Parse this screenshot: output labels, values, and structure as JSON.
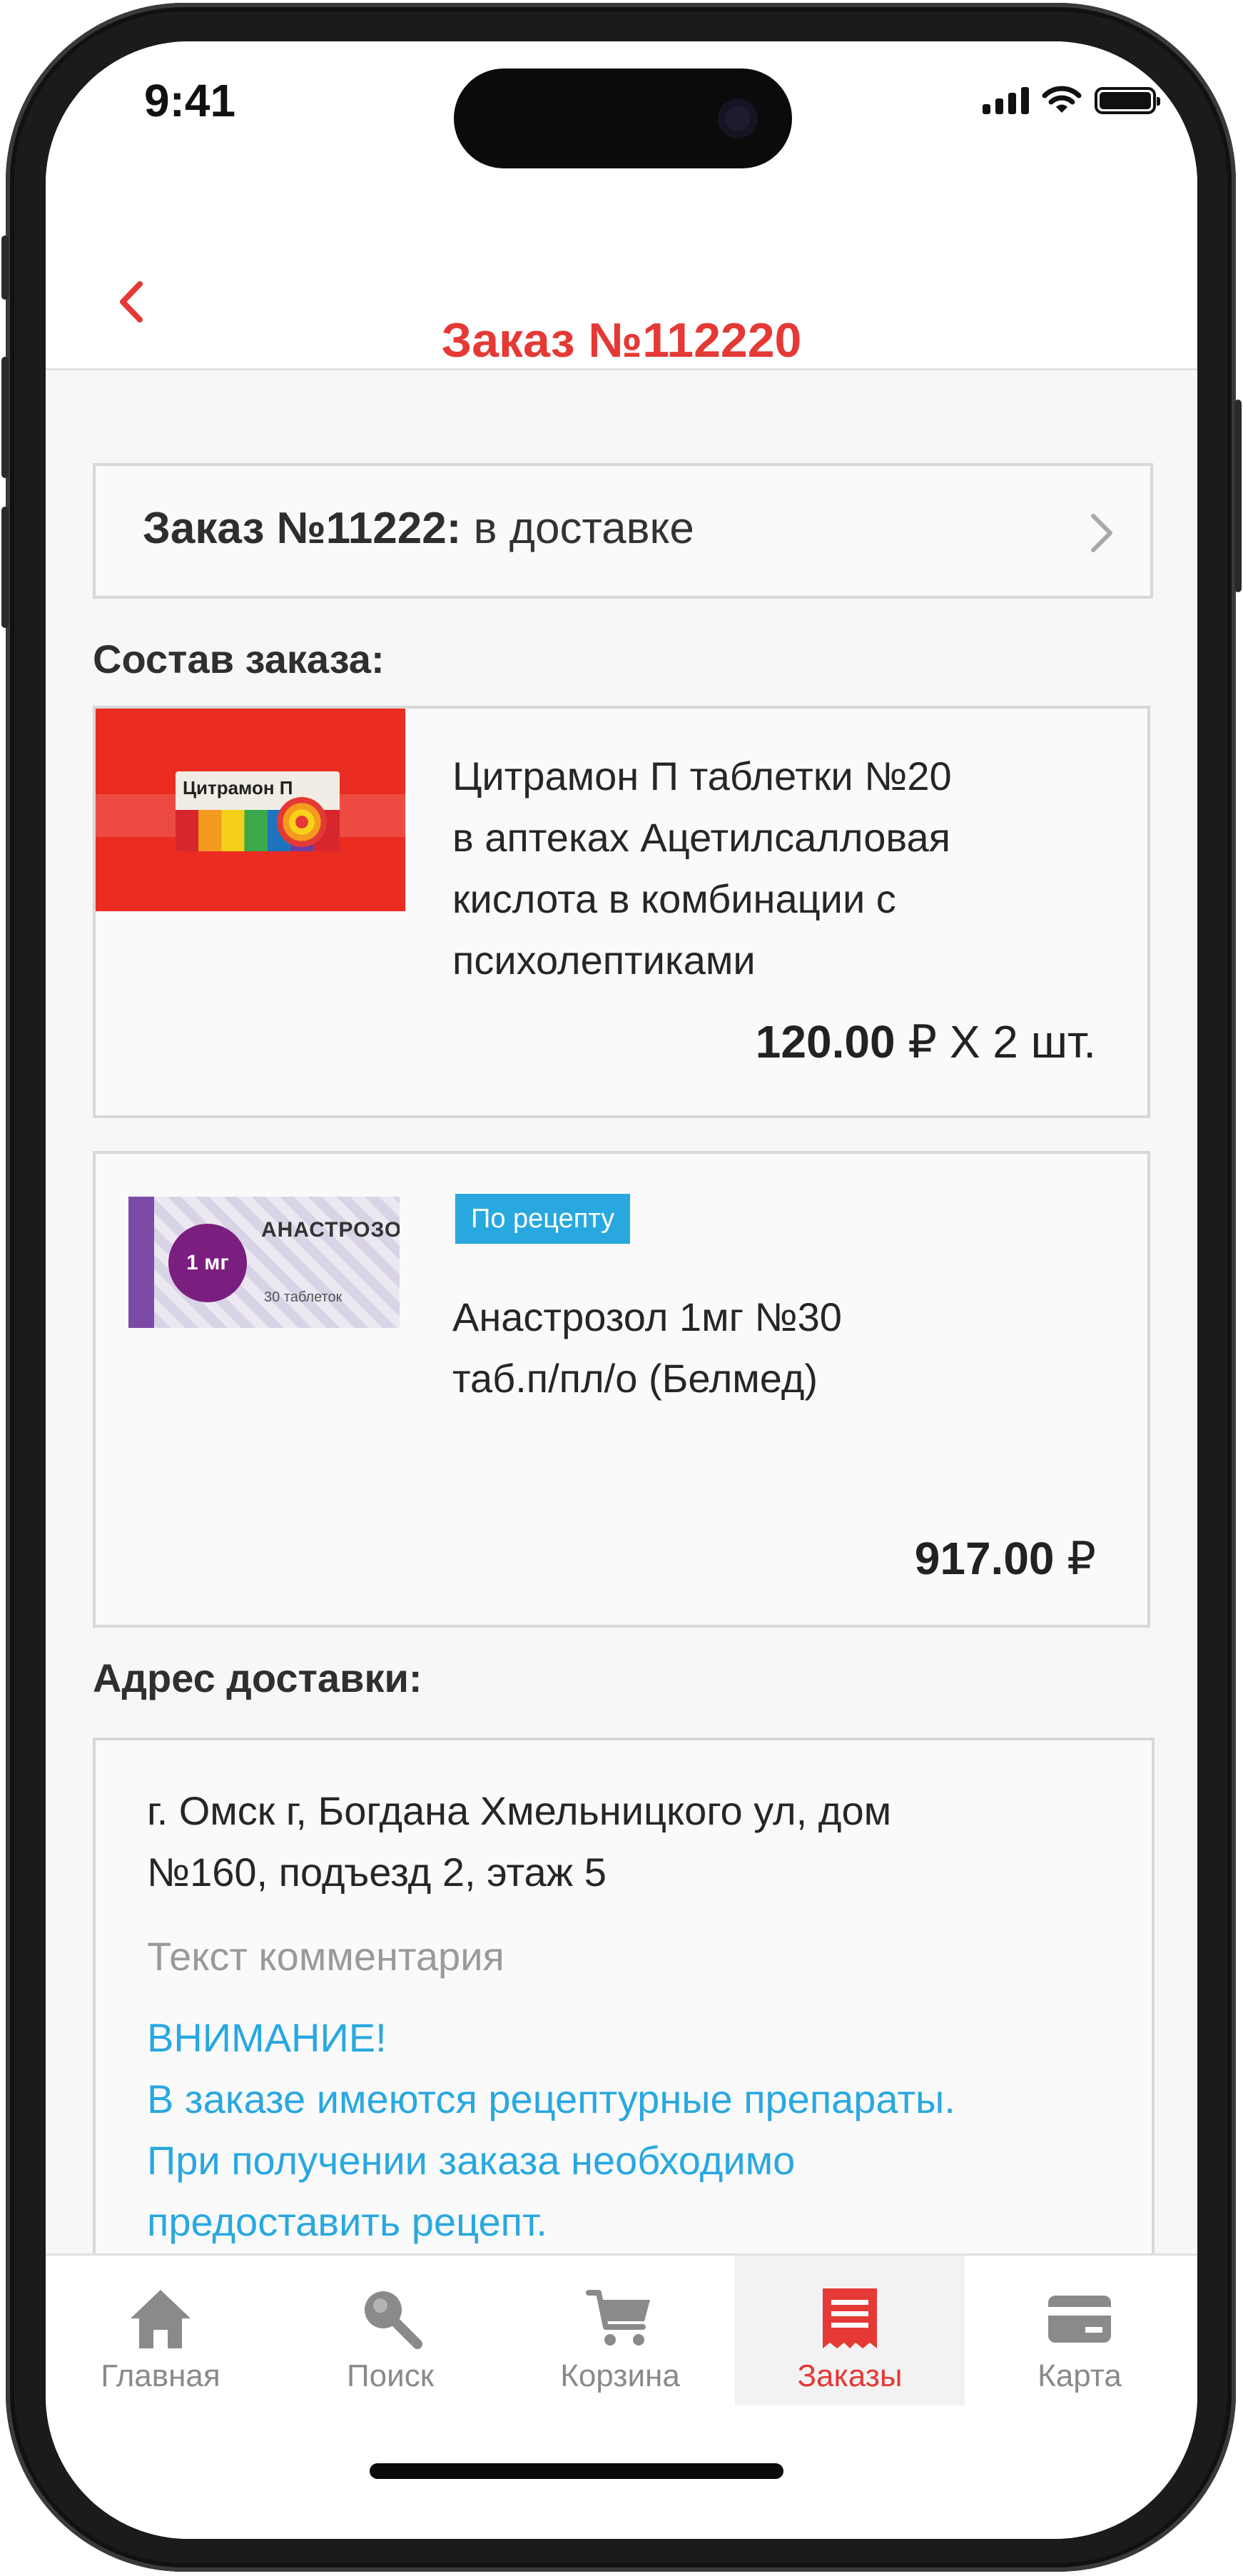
{
  "status_bar": {
    "time": "9:41",
    "icons": [
      "signal-icon",
      "wifi-icon",
      "battery-icon"
    ]
  },
  "header": {
    "title": "Заказ №112220",
    "back_icon": "chevron-left-icon"
  },
  "order_status": {
    "label": "Заказ №11222:",
    "status": " в доставке",
    "chevron_icon": "chevron-right-icon"
  },
  "order_items_title": "Состав заказа:",
  "items": [
    {
      "image": {
        "brand_text": "Цитрамон П"
      },
      "name_lines": [
        "Цитрамон П таблетки №20",
        "в аптеках Ацетилсалловая",
        "кислота в комбинации с",
        "психолептиками"
      ],
      "price": "120.00",
      "currency": " ₽",
      "quantity": "  X 2 шт.",
      "badge": ""
    },
    {
      "image": {
        "brand_text": "АНАСТРОЗОЛ",
        "dose": "1 мг",
        "note": "30 таблеток"
      },
      "name_lines": [
        "Анастрозол 1мг №30",
        "таб.п/пл/о (Белмед)"
      ],
      "price": "917.00",
      "currency": " ₽",
      "quantity": "",
      "badge": "По рецепту"
    }
  ],
  "address_title": "Адрес доставки:",
  "address": {
    "lines": [
      "г. Омск г, Богдана Хмельницкого ул, дом",
      "№160, подъезд 2, этаж 5"
    ],
    "comment": "Текст комментария",
    "warning_lines": [
      "ВНИМАНИЕ!",
      "В заказе имеются рецептурные препараты.",
      "При получении заказа необходимо",
      "предоставить рецепт."
    ]
  },
  "tabbar": {
    "tabs": [
      {
        "label": "Главная",
        "icon": "home-icon",
        "active": false
      },
      {
        "label": "Поиск",
        "icon": "search-icon",
        "active": false
      },
      {
        "label": "Корзина",
        "icon": "cart-icon",
        "active": false
      },
      {
        "label": "Заказы",
        "icon": "receipt-icon",
        "active": true
      },
      {
        "label": "Карта",
        "icon": "card-icon",
        "active": false
      }
    ]
  },
  "colors": {
    "accent": "#e53935",
    "info": "#29a8e0",
    "text": "#262626",
    "muted": "#9a9a9a",
    "tab_inactive": "#8a8a8a"
  }
}
